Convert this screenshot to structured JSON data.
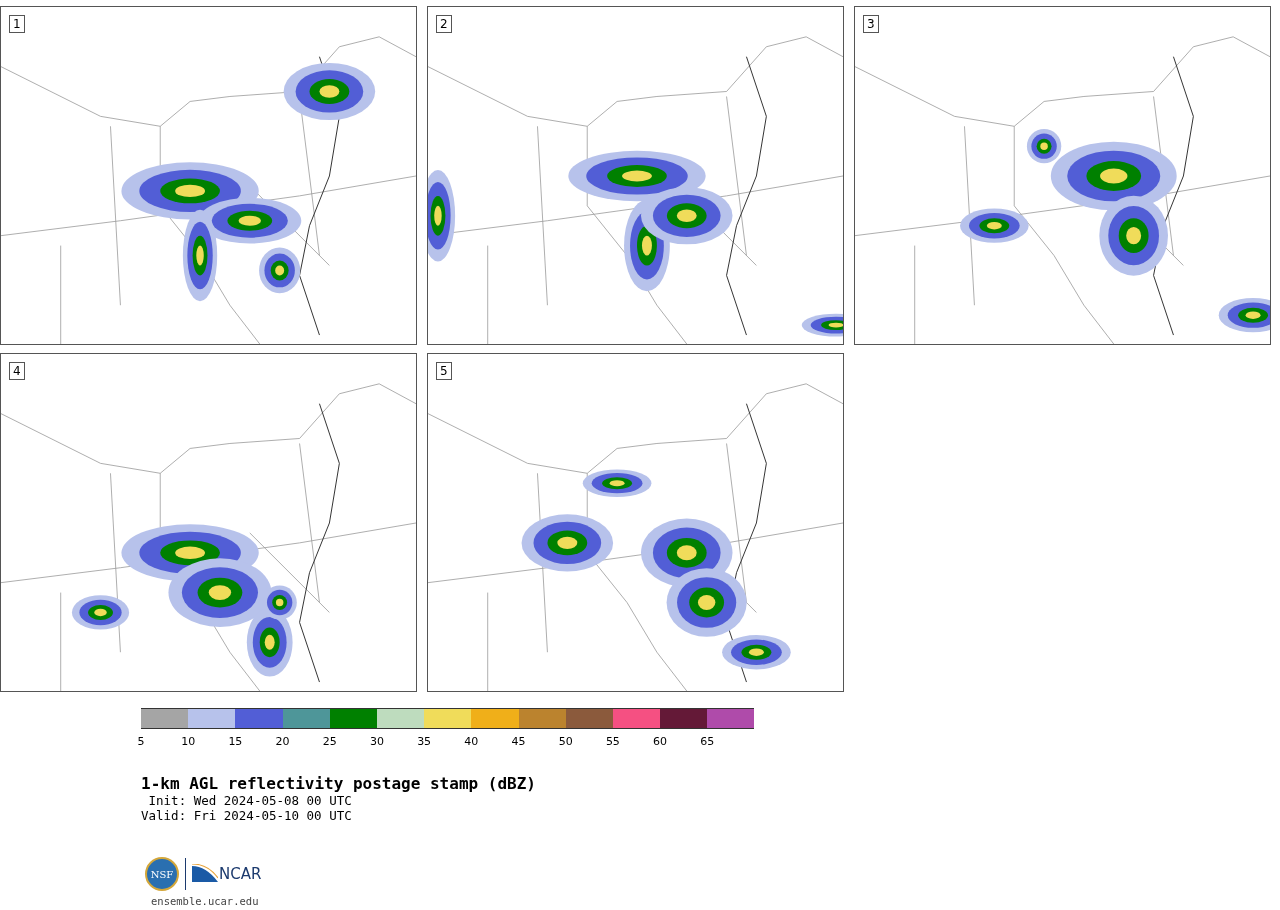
{
  "panels": [
    {
      "label": "1"
    },
    {
      "label": "2"
    },
    {
      "label": "3"
    },
    {
      "label": "4"
    },
    {
      "label": "5"
    }
  ],
  "colorbar": [
    {
      "label": "5",
      "color": "#a5a5a5"
    },
    {
      "label": "10",
      "color": "#b7c2eb"
    },
    {
      "label": "15",
      "color": "#525ed6"
    },
    {
      "label": "20",
      "color": "#4e9699"
    },
    {
      "label": "25",
      "color": "#008000"
    },
    {
      "label": "30",
      "color": "#bedcbe"
    },
    {
      "label": "35",
      "color": "#f0dc5a"
    },
    {
      "label": "40",
      "color": "#f0af19"
    },
    {
      "label": "45",
      "color": "#bb832e"
    },
    {
      "label": "50",
      "color": "#8b5a3c"
    },
    {
      "label": "55",
      "color": "#f55082"
    },
    {
      "label": "60",
      "color": "#641937"
    },
    {
      "label": "65",
      "color": "#af4baa"
    }
  ],
  "title": "1-km AGL reflectivity postage stamp (dBZ)",
  "init": " Init: Wed 2024-05-08 00 UTC",
  "valid": "Valid: Fri 2024-05-10 00 UTC",
  "logo": {
    "left": "NSF",
    "right": "NCAR"
  },
  "url": "ensemble.ucar.edu"
}
